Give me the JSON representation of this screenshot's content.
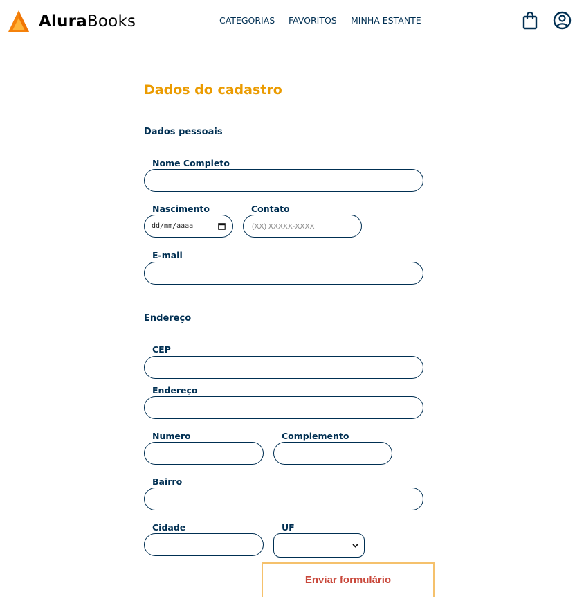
{
  "brand": {
    "name_bold": "Alura",
    "name_regular": "Books",
    "logo_colors": [
      "#f5820b",
      "#ffb43a",
      "#eb6b00"
    ]
  },
  "nav": {
    "categories": "CATEGORIAS",
    "favorites": "FAVORITOS",
    "shelf": "MINHA ESTANTE"
  },
  "icons": {
    "bag": "shopping-bag-icon",
    "user": "user-circle-icon"
  },
  "form": {
    "title": "Dados do cadastro",
    "personal": {
      "section": "Dados pessoais",
      "name_label": "Nome Completo",
      "birth_label": "Nascimento",
      "birth_placeholder": "dd/mm/aaaa",
      "contact_label": "Contato",
      "contact_placeholder": "(XX) XXXXX-XXXX",
      "email_label": "E-mail"
    },
    "address": {
      "section": "Endereço",
      "cep_label": "CEP",
      "street_label": "Endereço",
      "number_label": "Numero",
      "complement_label": "Complemento",
      "district_label": "Bairro",
      "city_label": "Cidade",
      "uf_label": "UF",
      "uf_value": ""
    },
    "submit": "Enviar formulário"
  },
  "colors": {
    "primary": "#002f52",
    "accent": "#eb9b00",
    "button_text": "#c9483b",
    "button_border": "#f5c16c"
  }
}
